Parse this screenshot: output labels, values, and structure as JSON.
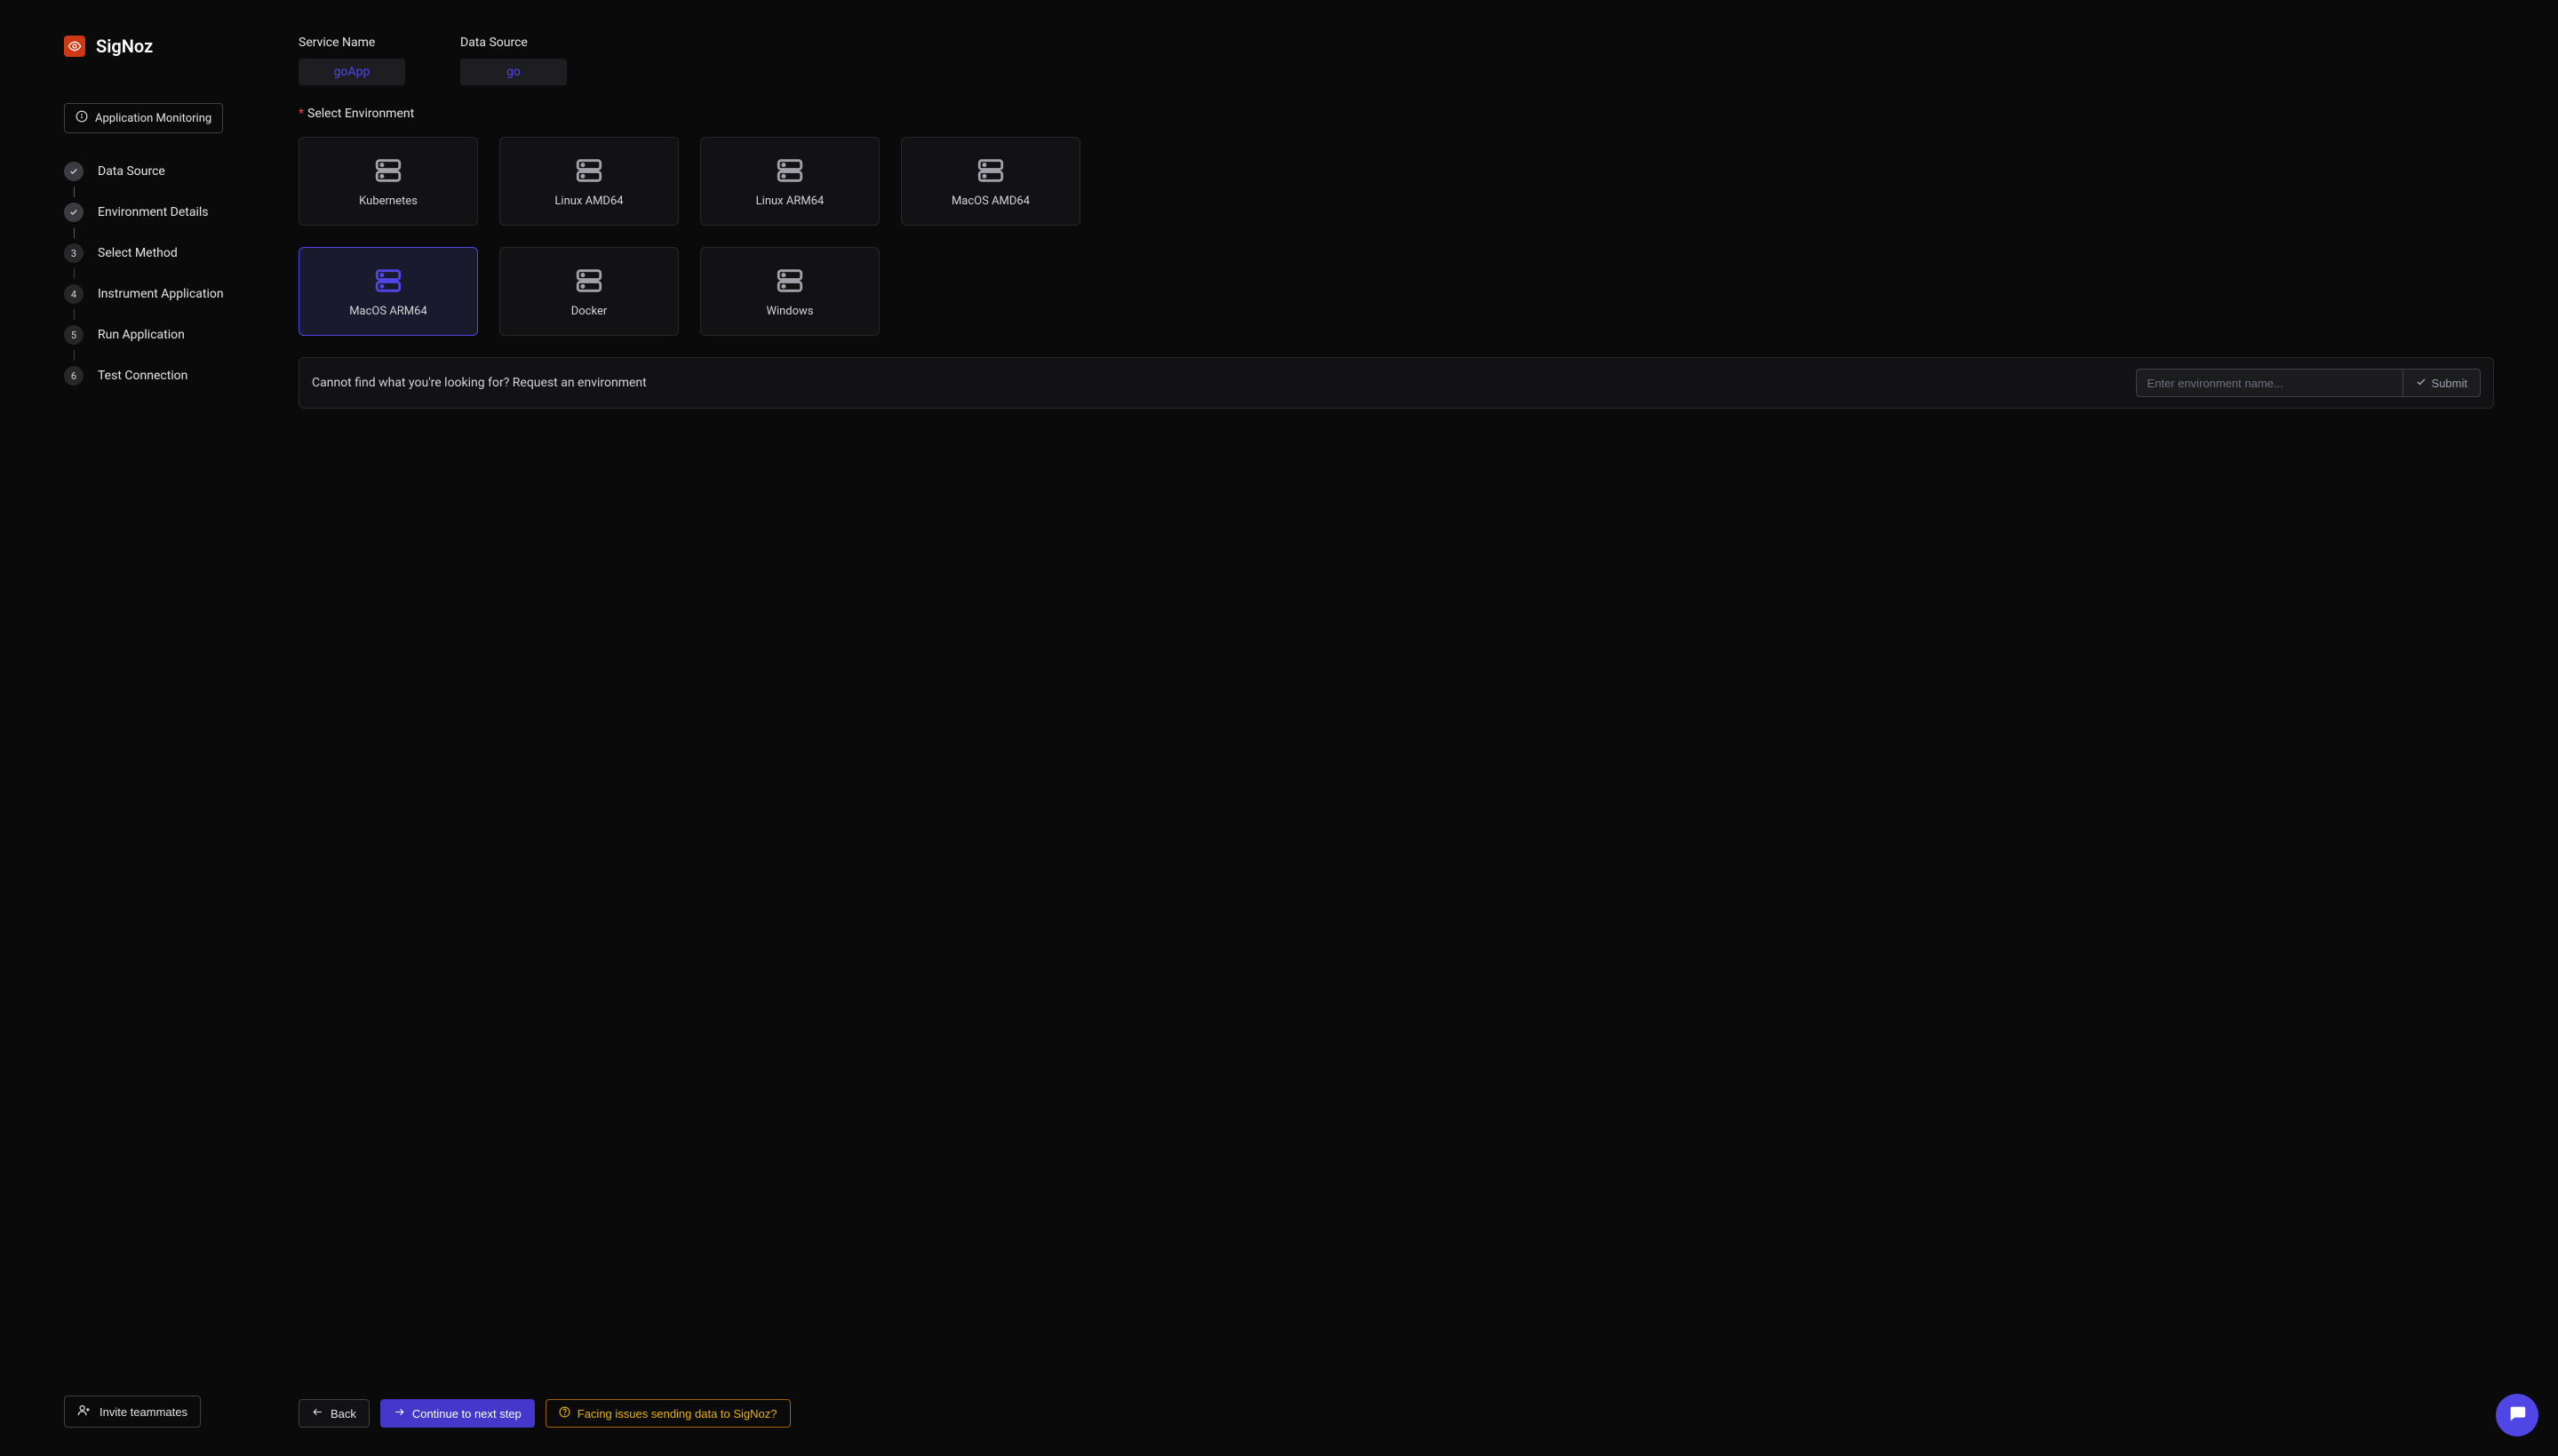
{
  "brand": {
    "name": "SigNoz"
  },
  "context_pill": {
    "label": "Application Monitoring"
  },
  "steps": [
    {
      "label": "Data Source",
      "state": "done"
    },
    {
      "label": "Environment Details",
      "state": "done"
    },
    {
      "label": "Select Method",
      "state": "pending",
      "num": "3"
    },
    {
      "label": "Instrument Application",
      "state": "pending",
      "num": "4"
    },
    {
      "label": "Run Application",
      "state": "pending",
      "num": "5"
    },
    {
      "label": "Test Connection",
      "state": "pending",
      "num": "6"
    }
  ],
  "invite_button": "Invite teammates",
  "summary": {
    "service_name": {
      "label": "Service Name",
      "value": "goApp"
    },
    "data_source": {
      "label": "Data Source",
      "value": "go"
    }
  },
  "section": {
    "required_mark": "*",
    "title": "Select Environment"
  },
  "environments": [
    {
      "label": "Kubernetes",
      "selected": false
    },
    {
      "label": "Linux AMD64",
      "selected": false
    },
    {
      "label": "Linux ARM64",
      "selected": false
    },
    {
      "label": "MacOS AMD64",
      "selected": false
    },
    {
      "label": "MacOS ARM64",
      "selected": true
    },
    {
      "label": "Docker",
      "selected": false
    },
    {
      "label": "Windows",
      "selected": false
    }
  ],
  "request_row": {
    "text": "Cannot find what you're looking for? Request an environment",
    "input_placeholder": "Enter environment name...",
    "submit_label": "Submit"
  },
  "footer": {
    "back": "Back",
    "continue": "Continue to next step",
    "issues": "Facing issues sending data to SigNoz?"
  }
}
